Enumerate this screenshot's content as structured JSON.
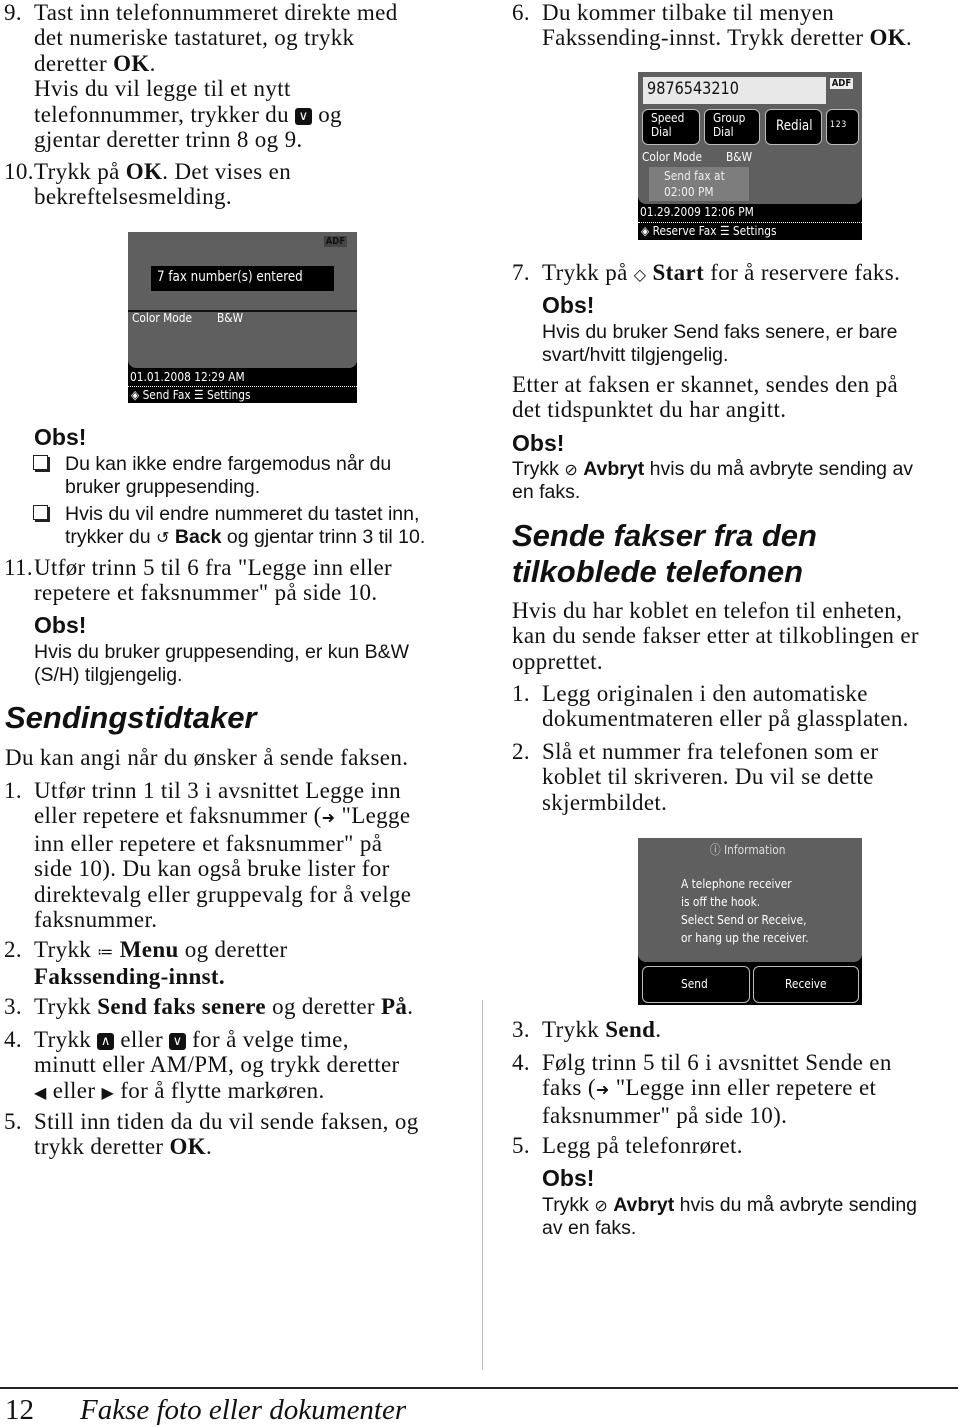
{
  "left": {
    "item9": {
      "num": "9.",
      "lines": [
        [
          "Tast inn telefonnummeret direkte med"
        ],
        [
          "det numeriske tastaturet, og trykk"
        ],
        [
          "deretter ",
          {
            "b": "OK"
          },
          "."
        ],
        [
          "Hvis du vil legge til et nytt"
        ],
        [
          "telefonnummer, trykker du ",
          {
            "icon": "down"
          },
          " og"
        ],
        [
          "gjentar deretter trinn 8 og 9."
        ]
      ]
    },
    "item10": {
      "num": "10.",
      "lines": [
        [
          "Trykk på ",
          {
            "b": "OK"
          },
          ". Det vises en"
        ],
        [
          "bekreftelsesmelding."
        ]
      ]
    },
    "lcd1": {
      "adf": "ADF",
      "message": "7 fax number(s) entered",
      "color_mode_label": "Color Mode",
      "color_mode_value": "B&W",
      "datetime": "01.01.2008  12:29 AM",
      "start_label": "Send Fax",
      "settings_label": "Settings"
    },
    "obs1": "Obs!",
    "bullet1": {
      "lines": [
        [
          "Du kan ikke endre fargemodus når du"
        ],
        [
          "bruker gruppesending."
        ]
      ]
    },
    "bullet2": {
      "lines": [
        [
          "Hvis du vil endre nummeret du tastet inn,"
        ],
        [
          "trykker du ",
          {
            "icon": "back"
          },
          " ",
          {
            "b": "Back"
          },
          " og gjentar trinn 3 til 10."
        ]
      ]
    },
    "item11": {
      "num": "11.",
      "lines": [
        [
          "Utfør trinn 5 til 6 fra \"Legge inn eller"
        ],
        [
          "repetere et faksnummer\" på side 10."
        ]
      ]
    },
    "obs2": "Obs!",
    "obs2_text": {
      "lines": [
        [
          "Hvis du bruker gruppesending, er kun B&W"
        ],
        [
          "(S/H) tilgjengelig."
        ]
      ]
    },
    "heading": "Sendingstidtaker",
    "intro": "Du kan angi når du ønsker å sende faksen.",
    "step1": {
      "num": "1.",
      "lines": [
        [
          "Utfør trinn 1 til 3 i avsnittet Legge inn"
        ],
        [
          "eller repetere et faksnummer (",
          {
            "icon": "arrow"
          },
          " \"Legge"
        ],
        [
          "inn eller repetere et faksnummer\" på"
        ],
        [
          "side 10). Du kan også bruke lister for"
        ],
        [
          "direktevalg eller gruppevalg for å velge"
        ],
        [
          "faksnummer."
        ]
      ]
    },
    "step2": {
      "num": "2.",
      "lines": [
        [
          "Trykk ",
          {
            "icon": "menu"
          },
          " ",
          {
            "b": "Menu"
          },
          " og deretter"
        ],
        [
          {
            "b": "Fakssending-innst."
          }
        ]
      ]
    },
    "step3": {
      "num": "3.",
      "lines": [
        [
          "Trykk ",
          {
            "b": "Send faks senere"
          },
          " og deretter ",
          {
            "b": "På"
          },
          "."
        ]
      ]
    },
    "step4": {
      "num": "4.",
      "lines": [
        [
          "Trykk ",
          {
            "icon": "up"
          },
          " eller ",
          {
            "icon": "down"
          },
          " for å velge time,"
        ],
        [
          "minutt eller AM/PM, og trykk deretter"
        ],
        [
          {
            "icon": "left"
          },
          " eller ",
          {
            "icon": "right"
          },
          " for å flytte markøren."
        ]
      ]
    },
    "step5": {
      "num": "5.",
      "lines": [
        [
          "Still inn tiden da du vil sende faksen, og"
        ],
        [
          "trykk deretter ",
          {
            "b": "OK"
          },
          "."
        ]
      ]
    }
  },
  "right": {
    "step6": {
      "num": "6.",
      "lines": [
        [
          "Du kommer tilbake til menyen"
        ],
        [
          "Fakssending-innst. Trykk deretter ",
          {
            "b": "OK"
          },
          "."
        ]
      ]
    },
    "lcd2": {
      "number": "9876543210",
      "adf": "ADF",
      "speed_dial": [
        "Speed",
        "Dial"
      ],
      "group_dial": [
        "Group",
        "Dial"
      ],
      "redial": "Redial",
      "keypad": "123",
      "color_mode_label": "Color Mode",
      "color_mode_value": "B&W",
      "send_at": [
        "Send fax at",
        "02:00 PM"
      ],
      "datetime": "01.29.2009  12:06 PM",
      "start_label": "Reserve Fax",
      "settings_label": "Settings"
    },
    "step7": {
      "num": "7.",
      "lines": [
        [
          "Trykk på ",
          {
            "icon": "start"
          },
          " ",
          {
            "b": "Start"
          },
          " for å reservere faks."
        ]
      ]
    },
    "obs3": "Obs!",
    "obs3_text": {
      "lines": [
        [
          "Hvis du bruker Send faks senere, er bare"
        ],
        [
          "svart/hvitt tilgjengelig."
        ]
      ]
    },
    "para1": {
      "lines": [
        [
          "Etter at faksen er skannet, sendes den på"
        ],
        [
          "det tidspunktet du har angitt."
        ]
      ]
    },
    "obs4": "Obs!",
    "obs4_text": {
      "lines": [
        [
          "Trykk ",
          {
            "icon": "stop"
          },
          " ",
          {
            "b": "Avbryt"
          },
          " hvis du må avbryte sending av"
        ],
        [
          "en faks."
        ]
      ]
    },
    "heading": {
      "lines": [
        [
          "Sende fakser fra den"
        ],
        [
          "tilkoblede telefonen"
        ]
      ]
    },
    "para2": {
      "lines": [
        [
          "Hvis du har koblet en telefon til enheten,"
        ],
        [
          "kan du sende fakser etter at tilkoblingen er"
        ],
        [
          "opprettet."
        ]
      ]
    },
    "q1": {
      "num": "1.",
      "lines": [
        [
          "Legg originalen i den automatiske"
        ],
        [
          "dokumentmateren eller på glassplaten."
        ]
      ]
    },
    "q2": {
      "num": "2.",
      "lines": [
        [
          "Slå et nummer fra telefonen som er"
        ],
        [
          "koblet til skriveren. Du vil se dette"
        ],
        [
          "skjermbildet."
        ]
      ]
    },
    "lcd3": {
      "title": "Information",
      "message": [
        "A telephone receiver",
        "is off the hook.",
        "Select Send or Receive,",
        "or hang up the receiver."
      ],
      "send": "Send",
      "receive": "Receive"
    },
    "q3": {
      "num": "3.",
      "lines": [
        [
          "Trykk ",
          {
            "b": "Send"
          },
          "."
        ]
      ]
    },
    "q4": {
      "num": "4.",
      "lines": [
        [
          "Følg trinn 5 til 6 i avsnittet Sende en"
        ],
        [
          "faks (",
          {
            "icon": "arrow"
          },
          " \"Legge inn eller repetere et"
        ],
        [
          "faksnummer\" på side 10)."
        ]
      ]
    },
    "q5": {
      "num": "5.",
      "lines": [
        [
          "Legg på telefonrøret."
        ]
      ]
    },
    "obs5": "Obs!",
    "obs5_text": {
      "lines": [
        [
          "Trykk ",
          {
            "icon": "stop"
          },
          " ",
          {
            "b": "Avbryt"
          },
          " hvis du må avbryte sending"
        ],
        [
          "av en faks."
        ]
      ]
    }
  },
  "footer": {
    "page_number": "12",
    "title": "Fakse foto eller dokumenter"
  }
}
